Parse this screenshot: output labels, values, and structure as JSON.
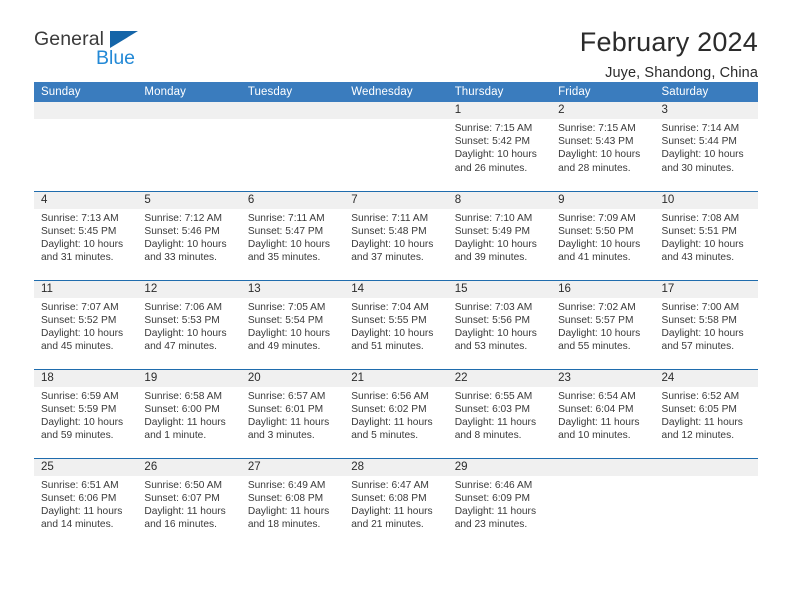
{
  "brand": {
    "word_one": "General",
    "word_two": "Blue",
    "flag_icon": "triangle-flag-icon",
    "accent_color": "#1565a8",
    "blue_text_color": "#2389d6"
  },
  "header": {
    "title": "February 2024",
    "location": "Juye, Shandong, China"
  },
  "theme": {
    "header_bg": "#3a7cbe",
    "row_border": "#1f6cad",
    "daynum_bg": "#f0f0f0"
  },
  "calendar": {
    "weekday_headers": [
      "Sunday",
      "Monday",
      "Tuesday",
      "Wednesday",
      "Thursday",
      "Friday",
      "Saturday"
    ],
    "weeks": [
      [
        {
          "day": "",
          "sunrise": "",
          "sunset": "",
          "daylight_line1": "",
          "daylight_line2": ""
        },
        {
          "day": "",
          "sunrise": "",
          "sunset": "",
          "daylight_line1": "",
          "daylight_line2": ""
        },
        {
          "day": "",
          "sunrise": "",
          "sunset": "",
          "daylight_line1": "",
          "daylight_line2": ""
        },
        {
          "day": "",
          "sunrise": "",
          "sunset": "",
          "daylight_line1": "",
          "daylight_line2": ""
        },
        {
          "day": "1",
          "sunrise": "Sunrise: 7:15 AM",
          "sunset": "Sunset: 5:42 PM",
          "daylight_line1": "Daylight: 10 hours",
          "daylight_line2": "and 26 minutes."
        },
        {
          "day": "2",
          "sunrise": "Sunrise: 7:15 AM",
          "sunset": "Sunset: 5:43 PM",
          "daylight_line1": "Daylight: 10 hours",
          "daylight_line2": "and 28 minutes."
        },
        {
          "day": "3",
          "sunrise": "Sunrise: 7:14 AM",
          "sunset": "Sunset: 5:44 PM",
          "daylight_line1": "Daylight: 10 hours",
          "daylight_line2": "and 30 minutes."
        }
      ],
      [
        {
          "day": "4",
          "sunrise": "Sunrise: 7:13 AM",
          "sunset": "Sunset: 5:45 PM",
          "daylight_line1": "Daylight: 10 hours",
          "daylight_line2": "and 31 minutes."
        },
        {
          "day": "5",
          "sunrise": "Sunrise: 7:12 AM",
          "sunset": "Sunset: 5:46 PM",
          "daylight_line1": "Daylight: 10 hours",
          "daylight_line2": "and 33 minutes."
        },
        {
          "day": "6",
          "sunrise": "Sunrise: 7:11 AM",
          "sunset": "Sunset: 5:47 PM",
          "daylight_line1": "Daylight: 10 hours",
          "daylight_line2": "and 35 minutes."
        },
        {
          "day": "7",
          "sunrise": "Sunrise: 7:11 AM",
          "sunset": "Sunset: 5:48 PM",
          "daylight_line1": "Daylight: 10 hours",
          "daylight_line2": "and 37 minutes."
        },
        {
          "day": "8",
          "sunrise": "Sunrise: 7:10 AM",
          "sunset": "Sunset: 5:49 PM",
          "daylight_line1": "Daylight: 10 hours",
          "daylight_line2": "and 39 minutes."
        },
        {
          "day": "9",
          "sunrise": "Sunrise: 7:09 AM",
          "sunset": "Sunset: 5:50 PM",
          "daylight_line1": "Daylight: 10 hours",
          "daylight_line2": "and 41 minutes."
        },
        {
          "day": "10",
          "sunrise": "Sunrise: 7:08 AM",
          "sunset": "Sunset: 5:51 PM",
          "daylight_line1": "Daylight: 10 hours",
          "daylight_line2": "and 43 minutes."
        }
      ],
      [
        {
          "day": "11",
          "sunrise": "Sunrise: 7:07 AM",
          "sunset": "Sunset: 5:52 PM",
          "daylight_line1": "Daylight: 10 hours",
          "daylight_line2": "and 45 minutes."
        },
        {
          "day": "12",
          "sunrise": "Sunrise: 7:06 AM",
          "sunset": "Sunset: 5:53 PM",
          "daylight_line1": "Daylight: 10 hours",
          "daylight_line2": "and 47 minutes."
        },
        {
          "day": "13",
          "sunrise": "Sunrise: 7:05 AM",
          "sunset": "Sunset: 5:54 PM",
          "daylight_line1": "Daylight: 10 hours",
          "daylight_line2": "and 49 minutes."
        },
        {
          "day": "14",
          "sunrise": "Sunrise: 7:04 AM",
          "sunset": "Sunset: 5:55 PM",
          "daylight_line1": "Daylight: 10 hours",
          "daylight_line2": "and 51 minutes."
        },
        {
          "day": "15",
          "sunrise": "Sunrise: 7:03 AM",
          "sunset": "Sunset: 5:56 PM",
          "daylight_line1": "Daylight: 10 hours",
          "daylight_line2": "and 53 minutes."
        },
        {
          "day": "16",
          "sunrise": "Sunrise: 7:02 AM",
          "sunset": "Sunset: 5:57 PM",
          "daylight_line1": "Daylight: 10 hours",
          "daylight_line2": "and 55 minutes."
        },
        {
          "day": "17",
          "sunrise": "Sunrise: 7:00 AM",
          "sunset": "Sunset: 5:58 PM",
          "daylight_line1": "Daylight: 10 hours",
          "daylight_line2": "and 57 minutes."
        }
      ],
      [
        {
          "day": "18",
          "sunrise": "Sunrise: 6:59 AM",
          "sunset": "Sunset: 5:59 PM",
          "daylight_line1": "Daylight: 10 hours",
          "daylight_line2": "and 59 minutes."
        },
        {
          "day": "19",
          "sunrise": "Sunrise: 6:58 AM",
          "sunset": "Sunset: 6:00 PM",
          "daylight_line1": "Daylight: 11 hours",
          "daylight_line2": "and 1 minute."
        },
        {
          "day": "20",
          "sunrise": "Sunrise: 6:57 AM",
          "sunset": "Sunset: 6:01 PM",
          "daylight_line1": "Daylight: 11 hours",
          "daylight_line2": "and 3 minutes."
        },
        {
          "day": "21",
          "sunrise": "Sunrise: 6:56 AM",
          "sunset": "Sunset: 6:02 PM",
          "daylight_line1": "Daylight: 11 hours",
          "daylight_line2": "and 5 minutes."
        },
        {
          "day": "22",
          "sunrise": "Sunrise: 6:55 AM",
          "sunset": "Sunset: 6:03 PM",
          "daylight_line1": "Daylight: 11 hours",
          "daylight_line2": "and 8 minutes."
        },
        {
          "day": "23",
          "sunrise": "Sunrise: 6:54 AM",
          "sunset": "Sunset: 6:04 PM",
          "daylight_line1": "Daylight: 11 hours",
          "daylight_line2": "and 10 minutes."
        },
        {
          "day": "24",
          "sunrise": "Sunrise: 6:52 AM",
          "sunset": "Sunset: 6:05 PM",
          "daylight_line1": "Daylight: 11 hours",
          "daylight_line2": "and 12 minutes."
        }
      ],
      [
        {
          "day": "25",
          "sunrise": "Sunrise: 6:51 AM",
          "sunset": "Sunset: 6:06 PM",
          "daylight_line1": "Daylight: 11 hours",
          "daylight_line2": "and 14 minutes."
        },
        {
          "day": "26",
          "sunrise": "Sunrise: 6:50 AM",
          "sunset": "Sunset: 6:07 PM",
          "daylight_line1": "Daylight: 11 hours",
          "daylight_line2": "and 16 minutes."
        },
        {
          "day": "27",
          "sunrise": "Sunrise: 6:49 AM",
          "sunset": "Sunset: 6:08 PM",
          "daylight_line1": "Daylight: 11 hours",
          "daylight_line2": "and 18 minutes."
        },
        {
          "day": "28",
          "sunrise": "Sunrise: 6:47 AM",
          "sunset": "Sunset: 6:08 PM",
          "daylight_line1": "Daylight: 11 hours",
          "daylight_line2": "and 21 minutes."
        },
        {
          "day": "29",
          "sunrise": "Sunrise: 6:46 AM",
          "sunset": "Sunset: 6:09 PM",
          "daylight_line1": "Daylight: 11 hours",
          "daylight_line2": "and 23 minutes."
        },
        {
          "day": "",
          "sunrise": "",
          "sunset": "",
          "daylight_line1": "",
          "daylight_line2": ""
        },
        {
          "day": "",
          "sunrise": "",
          "sunset": "",
          "daylight_line1": "",
          "daylight_line2": ""
        }
      ]
    ]
  }
}
